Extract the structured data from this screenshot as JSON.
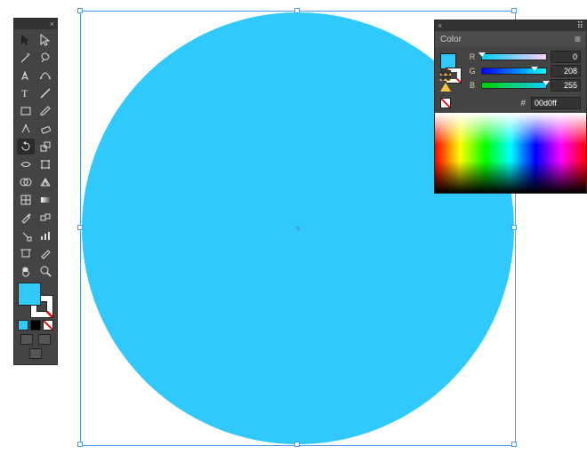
{
  "shape": {
    "kind": "ellipse"
  },
  "tools": {
    "close_glyph": "×",
    "menu_glyph": "»"
  },
  "color": {
    "title": "Color",
    "close_glyph": "×",
    "menu_glyph": "≡",
    "hash": "#",
    "hex": "00d0ff",
    "channels": {
      "r": {
        "label": "R",
        "value": "0",
        "pos": 0
      },
      "g": {
        "label": "G",
        "value": "208",
        "pos": 82
      },
      "b": {
        "label": "B",
        "value": "255",
        "pos": 100
      }
    },
    "fill_color": "#30c9fb"
  }
}
